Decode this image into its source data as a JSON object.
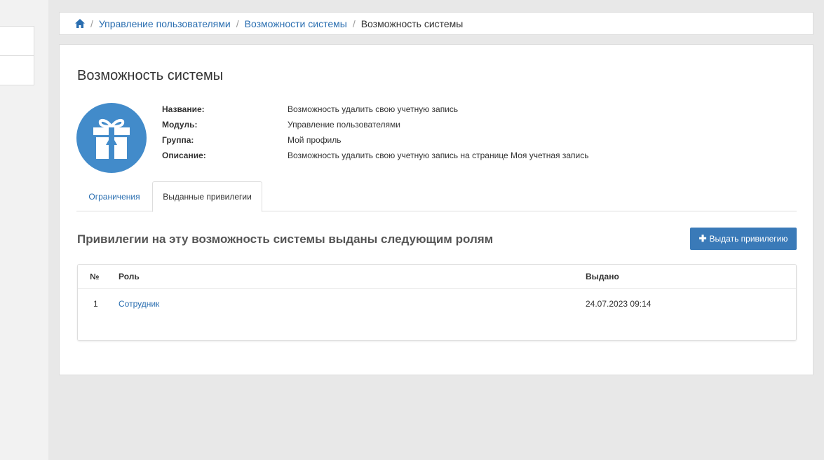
{
  "breadcrumb": {
    "items": [
      "Управление пользователями",
      "Возможности системы"
    ],
    "current": "Возможность системы"
  },
  "page": {
    "title": "Возможность системы"
  },
  "info": {
    "name_label": "Название:",
    "name_value": "Возможность удалить свою учетную запись",
    "module_label": "Модуль:",
    "module_value": "Управление пользователями",
    "group_label": "Группа:",
    "group_value": "Мой профиль",
    "description_label": "Описание:",
    "description_value": "Возможность удалить свою учетную запись на странице Моя учетная запись"
  },
  "tabs": [
    {
      "label": "Ограничения",
      "active": false
    },
    {
      "label": "Выданные привилегии",
      "active": true
    }
  ],
  "section": {
    "title": "Привилегии на эту возможность системы выданы следующим ролям",
    "grant_button": "Выдать привилегию"
  },
  "table": {
    "headers": {
      "num": "№",
      "role": "Роль",
      "issued": "Выдано"
    },
    "rows": [
      {
        "num": "1",
        "role": "Сотрудник",
        "issued": "24.07.2023 09:14"
      }
    ]
  },
  "colors": {
    "accent": "#428bca",
    "link": "#2a6eb0",
    "button": "#3a7ab8"
  },
  "icons": {
    "home": "home-icon",
    "avatar": "gift-icon",
    "button": "plus-icon"
  }
}
